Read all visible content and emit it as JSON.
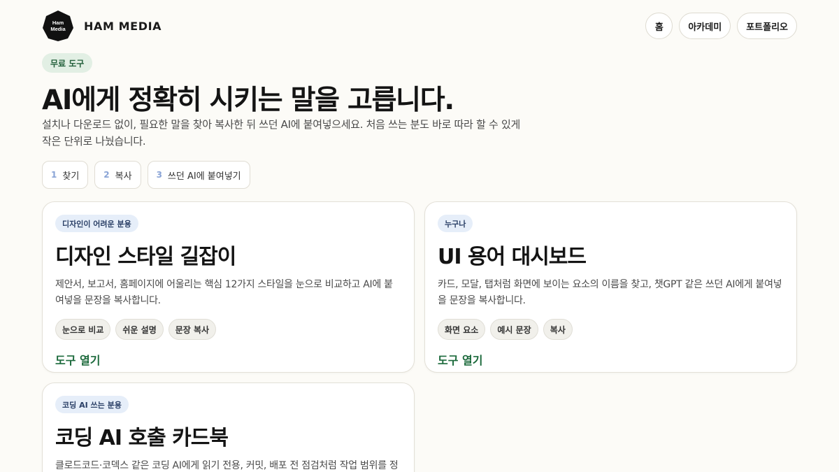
{
  "brand": {
    "logo_text": "Ham Media",
    "name": "HAM MEDIA"
  },
  "nav": [
    "홈",
    "아카데미",
    "포트폴리오"
  ],
  "hero": {
    "badge": "무료 도구",
    "title": "AI에게 정확히 시키는 말을 고릅니다.",
    "description": "설치나 다운로드 없이, 필요한 말을 찾아 복사한 뒤 쓰던 AI에 붙여넣으세요. 처음 쓰는 분도 바로 따라 할 수 있게 작은 단위로 나눴습니다."
  },
  "steps": [
    {
      "num": "1",
      "label": "찾기"
    },
    {
      "num": "2",
      "label": "복사"
    },
    {
      "num": "3",
      "label": "쓰던 AI에 붙여넣기"
    }
  ],
  "cards": [
    {
      "tag": "디자인이 어려운 분용",
      "title": "디자인 스타일 길잡이",
      "description": "제안서, 보고서, 홈페이지에 어울리는 핵심 12가지 스타일을 눈으로 비교하고 AI에 붙여넣을 문장을 복사합니다.",
      "chips": [
        "눈으로 비교",
        "쉬운 설명",
        "문장 복사"
      ],
      "link": "도구 열기"
    },
    {
      "tag": "누구나",
      "title": "UI 용어 대시보드",
      "description": "카드, 모달, 탭처럼 화면에 보이는 요소의 이름을 찾고, 챗GPT 같은 쓰던 AI에게 붙여넣을 문장을 복사합니다.",
      "chips": [
        "화면 요소",
        "예시 문장",
        "복사"
      ],
      "link": "도구 열기"
    },
    {
      "tag": "코딩 AI 쓰는 분용",
      "title": "코딩 AI 호출 카드북",
      "description": "클로드코드·코덱스 같은 코딩 AI에게 읽기 전용, 커밋, 배포 전 점검처럼 작업 범위를 정확히 말하게 돕습니다."
    }
  ],
  "colors": {
    "accent_green": "#1c6a3c",
    "badge_green_bg": "#e2efe4",
    "tag_blue_bg": "#e6eef9"
  }
}
